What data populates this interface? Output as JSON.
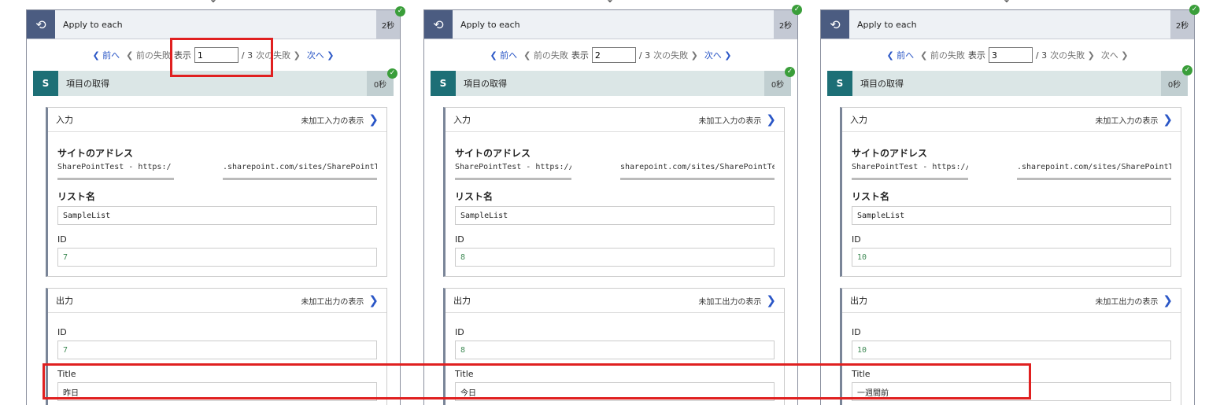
{
  "cards": [
    {
      "title": "Apply to each",
      "duration": "2秒",
      "pager": {
        "prev": "前へ",
        "prev_fail": "前の失敗",
        "show": "表示",
        "page": "1",
        "total": "/ 3",
        "next_fail": "次の失敗",
        "next": "次へ"
      },
      "action": {
        "title": "項目の取得",
        "duration": "0秒",
        "input": {
          "label": "入力",
          "raw": "未加工入力の表示",
          "site_label": "サイトのアドレス",
          "site_left": "SharePointTest - https:/",
          "site_right": ".sharepoint.com/sites/SharePointT",
          "list_label": "リスト名",
          "list_value": "SampleList",
          "id_label": "ID",
          "id_value": "7"
        },
        "output": {
          "label": "出力",
          "raw": "未加工出力の表示",
          "id_label": "ID",
          "id_value": "7",
          "title_label": "Title",
          "title_value": "昨日"
        }
      }
    },
    {
      "title": "Apply to each",
      "duration": "2秒",
      "pager": {
        "prev": "前へ",
        "prev_fail": "前の失敗",
        "show": "表示",
        "page": "2",
        "total": "/ 3",
        "next_fail": "次の失敗",
        "next": "次へ"
      },
      "action": {
        "title": "項目の取得",
        "duration": "0秒",
        "input": {
          "label": "入力",
          "raw": "未加工入力の表示",
          "site_label": "サイトのアドレス",
          "site_left": "SharePointTest - https://",
          "site_right": "sharepoint.com/sites/SharePointTe",
          "list_label": "リスト名",
          "list_value": "SampleList",
          "id_label": "ID",
          "id_value": "8"
        },
        "output": {
          "label": "出力",
          "raw": "未加工出力の表示",
          "id_label": "ID",
          "id_value": "8",
          "title_label": "Title",
          "title_value": "今日"
        }
      }
    },
    {
      "title": "Apply to each",
      "duration": "2秒",
      "pager": {
        "prev": "前へ",
        "prev_fail": "前の失敗",
        "show": "表示",
        "page": "3",
        "total": "/ 3",
        "next_fail": "次の失敗",
        "next": "次へ"
      },
      "action": {
        "title": "項目の取得",
        "duration": "0秒",
        "input": {
          "label": "入力",
          "raw": "未加工入力の表示",
          "site_label": "サイトのアドレス",
          "site_left": "SharePointTest - https://",
          "site_right": ".sharepoint.com/sites/SharePointTe",
          "list_label": "リスト名",
          "list_value": "SampleList",
          "id_label": "ID",
          "id_value": "10"
        },
        "output": {
          "label": "出力",
          "raw": "未加工出力の表示",
          "id_label": "ID",
          "id_value": "10",
          "title_label": "Title",
          "title_value": "一週間前"
        }
      }
    }
  ],
  "colors": {
    "loop_header": "#4b5c81",
    "sharepoint": "#1d6f76",
    "link": "#2a56c6",
    "highlight": "#e02020",
    "success": "#3a9e3a"
  }
}
